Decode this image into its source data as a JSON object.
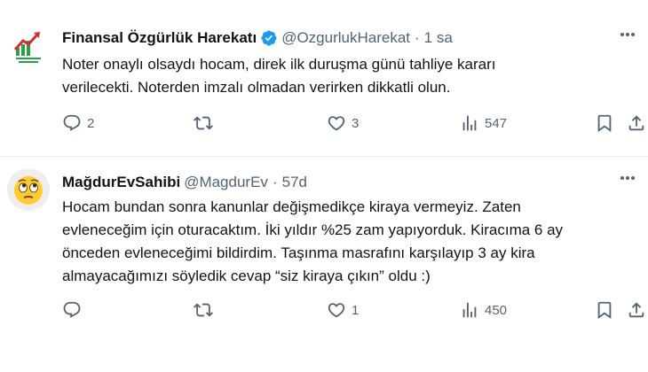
{
  "tweets": [
    {
      "author_name": "Finansal Özgürlük Harekatı",
      "verified": true,
      "handle": "@OzgurlukHarekat",
      "separator": "·",
      "time": "1 sa",
      "avatar_icon": "logo-chart-icon",
      "text_lines": [
        "Noter onaylı olsaydı hocam, direk ilk duruşma günü tahliye kararı",
        "verilecekti. Noterden imzalı olmadan verirken dikkatli olun."
      ],
      "replies": "2",
      "retweets": "",
      "likes": "3",
      "views": "547"
    },
    {
      "author_name": "MağdurEvSahibi",
      "verified": false,
      "handle": "@MagdurEv",
      "separator": "·",
      "time": "57d",
      "avatar_icon": "emoji-face-icon",
      "text_lines": [
        "Hocam bundan sonra kanunlar değişmedikçe kiraya vermeyiz. Zaten",
        "evleneceğim için oturacaktım. İki yıldır %25 zam yapıyorduk. Kiracıma 6 ay",
        "önceden evleneceğimi bildirdim. Taşınma masrafını karşılayıp 3 ay kira",
        "almayacağımızı söyledik cevap “siz kiraya çıkın” oldu :)"
      ],
      "replies": "",
      "retweets": "",
      "likes": "1",
      "views": "450"
    }
  ],
  "colors": {
    "text": "#0f1419",
    "muted": "#536471",
    "verified": "#1d9bf0",
    "divider": "#e6ecf0"
  }
}
